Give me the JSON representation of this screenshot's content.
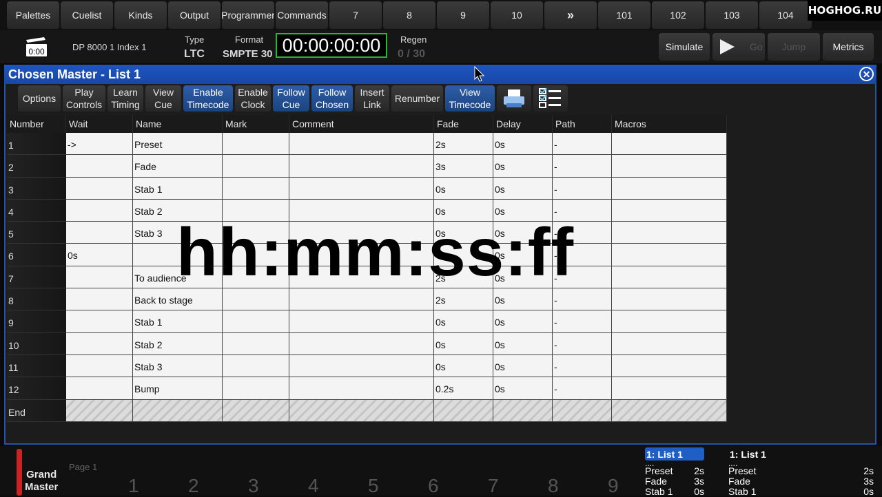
{
  "top_tabs": [
    "Palettes",
    "Cuelist",
    "Kinds",
    "Output",
    "Programmer",
    "Commands",
    "7",
    "8",
    "9",
    "10",
    "»",
    "101",
    "102",
    "103",
    "104"
  ],
  "watermark": "HOGHOG.RU",
  "status": {
    "clock_icon_text": "0:00",
    "dp_label": "DP 8000 1 Index 1",
    "type_label": "Type",
    "type_value": "LTC",
    "format_label": "Format",
    "format_value": "SMPTE 30",
    "timecode": "00:00:00:00",
    "regen_label": "Regen",
    "regen_value": "0 / 30"
  },
  "right_controls": {
    "simulate": "Simulate",
    "go": "Go",
    "jump": "Jump",
    "metrics": "Metrics"
  },
  "window": {
    "title": "Chosen Master - List 1",
    "close_icon": "close-circle-icon"
  },
  "toolbar": {
    "options": "Options",
    "play_controls": [
      "Play",
      "Controls"
    ],
    "learn_timing": [
      "Learn",
      "Timing"
    ],
    "view_cue": [
      "View",
      "Cue"
    ],
    "enable_timecode": [
      "Enable",
      "Timecode"
    ],
    "enable_clock": [
      "Enable",
      "Clock"
    ],
    "follow_cue": [
      "Follow",
      "Cue"
    ],
    "follow_chosen": [
      "Follow",
      "Chosen"
    ],
    "insert_link": [
      "Insert",
      "Link"
    ],
    "renumber": "Renumber",
    "view_timecode": [
      "View",
      "Timecode"
    ],
    "print_icon": "printer-icon",
    "checklist_icon": "checklist-icon"
  },
  "table": {
    "columns": [
      "Number",
      "Wait",
      "Name",
      "Mark",
      "Comment",
      "Fade",
      "Delay",
      "Path",
      "Macros"
    ],
    "rows": [
      [
        "1",
        "->",
        "Preset",
        "",
        "",
        "2s",
        "0s",
        "-",
        ""
      ],
      [
        "2",
        "",
        "Fade",
        "",
        "",
        "3s",
        "0s",
        "-",
        ""
      ],
      [
        "3",
        "",
        "Stab 1",
        "",
        "",
        "0s",
        "0s",
        "-",
        ""
      ],
      [
        "4",
        "",
        "Stab 2",
        "",
        "",
        "0s",
        "0s",
        "-",
        ""
      ],
      [
        "5",
        "",
        "Stab 3",
        "",
        "",
        "0s",
        "0s",
        "-",
        ""
      ],
      [
        "6",
        "0s",
        "",
        "",
        "",
        "4s",
        "0s",
        "-",
        ""
      ],
      [
        "7",
        "",
        "To audience",
        "",
        "",
        "2s",
        "0s",
        "-",
        ""
      ],
      [
        "8",
        "",
        "Back to stage",
        "",
        "",
        "2s",
        "0s",
        "-",
        ""
      ],
      [
        "9",
        "",
        "Stab 1",
        "",
        "",
        "0s",
        "0s",
        "-",
        ""
      ],
      [
        "10",
        "",
        "Stab 2",
        "",
        "",
        "0s",
        "0s",
        "-",
        ""
      ],
      [
        "11",
        "",
        "Stab 3",
        "",
        "",
        "0s",
        "0s",
        "-",
        ""
      ],
      [
        "12",
        "",
        "Bump",
        "",
        "",
        "0.2s",
        "0s",
        "-",
        ""
      ]
    ],
    "end_label": "End"
  },
  "overlay_text": "hh:mm:ss:ff",
  "bottom": {
    "grand_master": [
      "Grand",
      "Master"
    ],
    "page_label": "Page 1",
    "faders": [
      "1",
      "2",
      "3",
      "4",
      "5",
      "6",
      "7",
      "8",
      "9"
    ],
    "list_panel_1": {
      "title": "1: List 1",
      "dots": "....",
      "items": [
        [
          "Preset",
          "2s"
        ],
        [
          "Fade",
          "3s"
        ],
        [
          "Stab 1",
          "0s"
        ]
      ]
    },
    "list_panel_2": {
      "title": "1: List 1",
      "dots": "....",
      "items": [
        [
          "Preset",
          "2s"
        ],
        [
          "Fade",
          "3s"
        ],
        [
          "Stab 1",
          "0s"
        ]
      ]
    }
  }
}
